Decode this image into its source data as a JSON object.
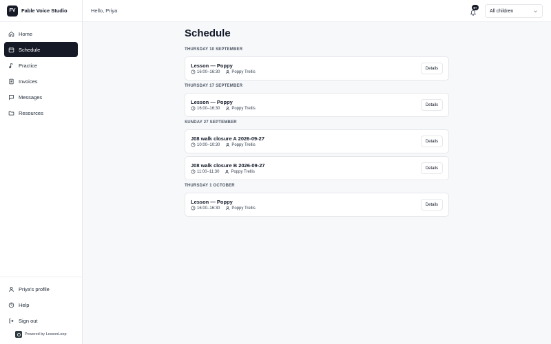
{
  "brand": {
    "badge": "FV",
    "name": "Fable Voice Studio"
  },
  "nav": [
    {
      "label": "Home",
      "icon": "home-icon"
    },
    {
      "label": "Schedule",
      "icon": "calendar-icon",
      "active": true
    },
    {
      "label": "Practice",
      "icon": "music-note-icon"
    },
    {
      "label": "Invoices",
      "icon": "invoice-icon"
    },
    {
      "label": "Messages",
      "icon": "message-icon"
    },
    {
      "label": "Resources",
      "icon": "folder-icon"
    }
  ],
  "footer_nav": [
    {
      "label": "Priya's profile",
      "icon": "user-icon"
    },
    {
      "label": "Help",
      "icon": "help-icon"
    },
    {
      "label": "Sign out",
      "icon": "sign-out-icon"
    }
  ],
  "powered_by": "Powered by LessonLoop",
  "header": {
    "greeting": "Hello, Priya",
    "notification_count": "9+",
    "child_filter": "All children"
  },
  "schedule": {
    "title": "Schedule",
    "details_label": "Details",
    "groups": [
      {
        "day": "THURSDAY 10 SEPTEMBER",
        "events": [
          {
            "title": "Lesson — Poppy",
            "time": "16:00–16:30",
            "person": "Poppy Trellis"
          }
        ]
      },
      {
        "day": "THURSDAY 17 SEPTEMBER",
        "events": [
          {
            "title": "Lesson — Poppy",
            "time": "16:00–16:30",
            "person": "Poppy Trellis"
          }
        ]
      },
      {
        "day": "SUNDAY 27 SEPTEMBER",
        "events": [
          {
            "title": "J08 walk closure A 2026-09-27",
            "time": "10:00–10:30",
            "person": "Poppy Trellis"
          },
          {
            "title": "J08 walk closure B 2026-09-27",
            "time": "11:00–11:30",
            "person": "Poppy Trellis"
          }
        ]
      },
      {
        "day": "THURSDAY 1 OCTOBER",
        "events": [
          {
            "title": "Lesson — Poppy",
            "time": "16:00–16:30",
            "person": "Poppy Trellis"
          }
        ]
      }
    ]
  },
  "colors": {
    "accent": "#161a26",
    "background": "#f7f8fa",
    "border": "#e5e7eb"
  }
}
